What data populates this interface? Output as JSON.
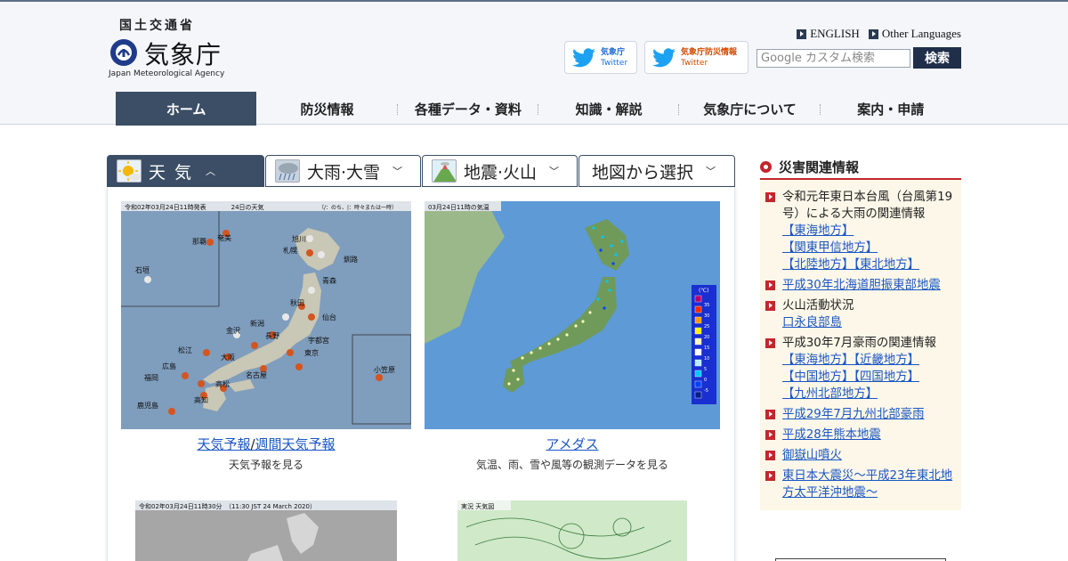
{
  "header": {
    "ministry": "国土交通省",
    "agency_name": "気象庁",
    "agency_english": "Japan Meteorological Agency",
    "lang_links": [
      "ENGLISH",
      "Other Languages"
    ],
    "twitter_buttons": [
      {
        "title": "気象庁",
        "sub": "Twitter"
      },
      {
        "title": "気象庁防災情報",
        "sub": "Twitter"
      }
    ],
    "search_placeholder": "Google カスタム検索",
    "search_button": "検索"
  },
  "nav": [
    "ホーム",
    "防災情報",
    "各種データ・資料",
    "知識・解説",
    "気象庁について",
    "案内・申請"
  ],
  "tabs": [
    "天 気",
    "大雨·大雪",
    "地震·火山",
    "地図から選択"
  ],
  "cards": [
    {
      "map_header": "令和02年03月24日11時発表　　　　24日の天気",
      "map_header2": "（/：のち、|：時々または一時）",
      "links": [
        "天気予報",
        "週間天気予報"
      ],
      "desc": "天気予報を見る",
      "cities": [
        "奄美",
        "那覇",
        "石垣",
        "旭川",
        "札幌",
        "釧路",
        "青森",
        "秋田",
        "仙台",
        "新潟",
        "金沢",
        "長野",
        "宇都宮",
        "東京",
        "松江",
        "大阪",
        "広島",
        "福岡",
        "高松",
        "名古屋",
        "高知",
        "鹿児島",
        "小笠原"
      ]
    },
    {
      "map_header": "03月24日11時の気温",
      "links": [
        "アメダス"
      ],
      "desc": "気温、雨、雪や風等の観測データを見る",
      "legend_unit": "(℃)",
      "legend_values": [
        "35",
        "30",
        "25",
        "20",
        "15",
        "10",
        "5",
        "0",
        "-5"
      ],
      "legend_colors": [
        "#b4006e",
        "#ff2800",
        "#ff9900",
        "#fff500",
        "#fffcb4",
        "#ffffff",
        "#b4f0ff",
        "#00c8ff",
        "#0041ff",
        "#001f8c"
      ]
    },
    {
      "map_header": "令和02年03月24日11時30分　（11:30 JST 24 March 2020）"
    },
    {
      "map_header": "実況 天気図"
    }
  ],
  "sidebar": {
    "title": "災害関連情報",
    "items": [
      {
        "text": "令和元年東日本台風（台風第19号）による大雨の関連情報",
        "links": [
          "【東海地方】",
          "【関東甲信地方】",
          "【北陸地方】【東北地方】"
        ]
      },
      {
        "links": [
          "平成30年北海道胆振東部地震"
        ]
      },
      {
        "text": "火山活動状況",
        "links": [
          "口永良部島"
        ]
      },
      {
        "text": "平成30年7月豪雨の関連情報",
        "links": [
          "【東海地方】【近畿地方】",
          "【中国地方】【四国地方】",
          "【九州北部地方】"
        ]
      },
      {
        "links": [
          "平成29年7月九州北部豪雨"
        ]
      },
      {
        "links": [
          "平成28年熊本地震"
        ]
      },
      {
        "links": [
          "御嶽山噴火"
        ]
      },
      {
        "links": [
          "東日本大震災～平成23年東北地方太平洋沖地震～"
        ]
      }
    ]
  },
  "colors": {
    "nav_active": "#3b4e66",
    "accent_red": "#c2272d",
    "link_blue": "#1a56c4",
    "sidebar_bg": "#fcf7e8"
  }
}
